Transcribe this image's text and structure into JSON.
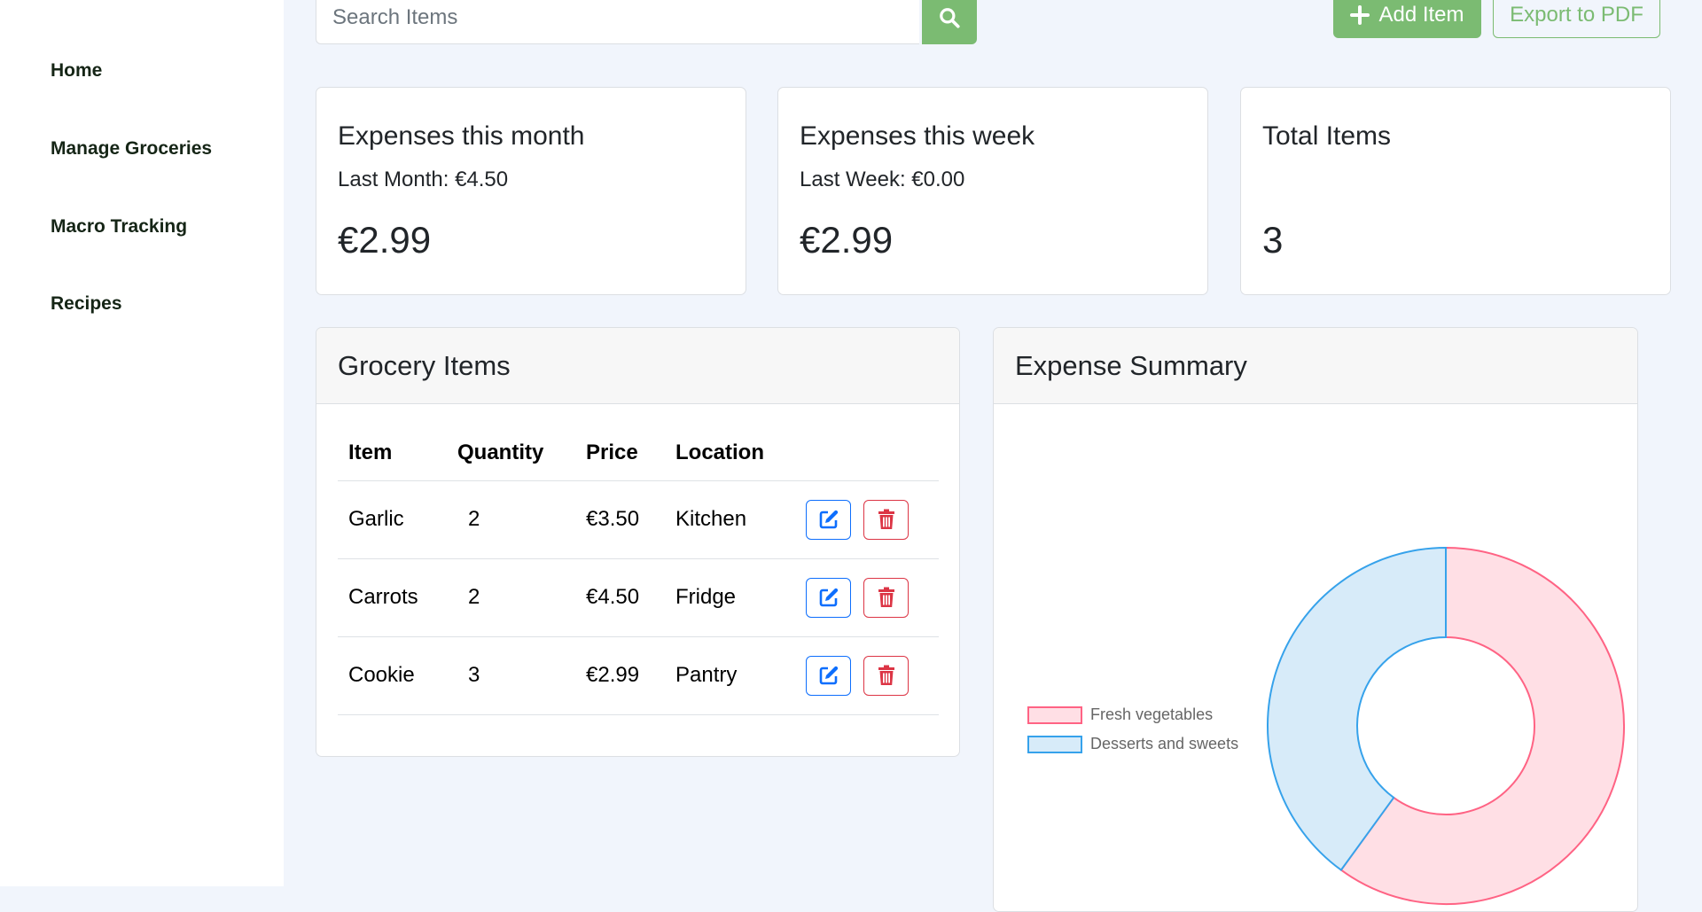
{
  "sidebar": {
    "items": [
      {
        "label": "Home"
      },
      {
        "label": "Manage Groceries"
      },
      {
        "label": "Macro Tracking"
      },
      {
        "label": "Recipes"
      }
    ]
  },
  "toolbar": {
    "search_placeholder": "Search Items",
    "search_icon": "search-icon",
    "add_label": "Add Item",
    "add_icon": "plus-icon",
    "export_label": "Export to PDF",
    "accent_color": "#7bbb72"
  },
  "stats": {
    "month": {
      "title": "Expenses this month",
      "sub": "Last Month: €4.50",
      "value": "€2.99"
    },
    "week": {
      "title": "Expenses this week",
      "sub": "Last Week: €0.00",
      "value": "€2.99"
    },
    "total": {
      "title": "Total Items",
      "sub": "",
      "value": "3"
    }
  },
  "grocery": {
    "title": "Grocery Items",
    "columns": [
      "Item",
      "Quantity",
      "Price",
      "Location"
    ],
    "rows": [
      {
        "item": "Garlic",
        "quantity": "2",
        "price": "€3.50",
        "location": "Kitchen"
      },
      {
        "item": "Carrots",
        "quantity": "2",
        "price": "€4.50",
        "location": "Fridge"
      },
      {
        "item": "Cookie",
        "quantity": "3",
        "price": "€2.99",
        "location": "Pantry"
      }
    ],
    "edit_icon": "edit-icon",
    "delete_icon": "trash-icon",
    "edit_color": "#0d6efd",
    "delete_color": "#dc3545"
  },
  "expense": {
    "title": "Expense Summary"
  },
  "chart_data": {
    "type": "pie",
    "variant": "doughnut",
    "title": "",
    "legend_position": "left",
    "categories": [
      "Fresh vegetables",
      "Desserts and sweets"
    ],
    "values": [
      60,
      40
    ],
    "colors": [
      {
        "fill": "#ffdfe5",
        "stroke": "#ff6384"
      },
      {
        "fill": "#d7ebf9",
        "stroke": "#36a2eb"
      }
    ]
  }
}
